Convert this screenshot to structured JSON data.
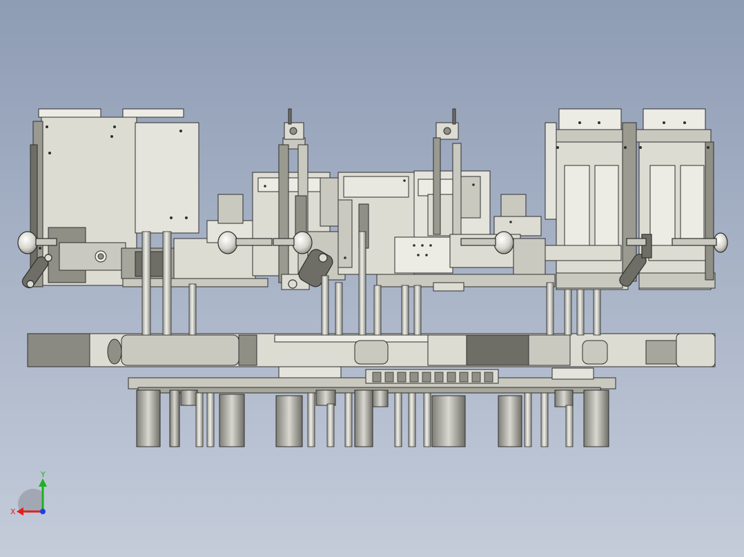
{
  "viewport": {
    "background_top": "#8e9cb4",
    "background_bottom": "#c4ccda"
  },
  "model": {
    "colors": {
      "panel": "#dcdcd2",
      "panel_light": "#ecece4",
      "panel_dark": "#8f8f85",
      "steel": "#c9c9c0",
      "dark": "#6e6e66",
      "outline": "#2e2e2e",
      "knob": "#e2e2da"
    }
  },
  "triad": {
    "x_label": "X",
    "y_label": "Y",
    "x_color": "#e02020",
    "y_color": "#20b020",
    "z_color": "#2040e0"
  }
}
